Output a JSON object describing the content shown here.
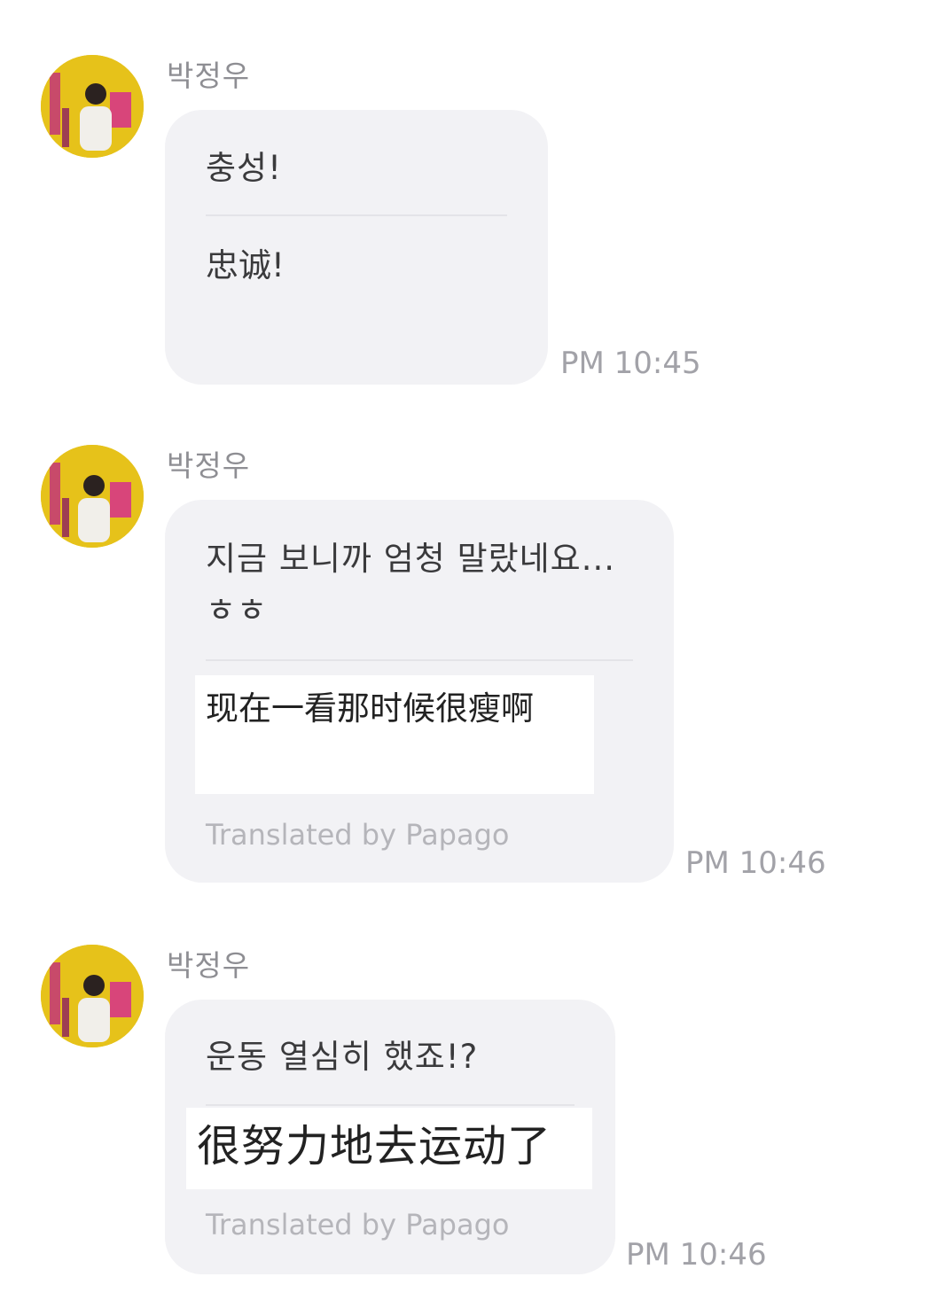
{
  "colors": {
    "bubble": "#f2f2f5",
    "sender": "#8e8e93",
    "timestamp": "#a2a2a8",
    "credit": "#b5b5ba",
    "avatar_background": "#e8c51b"
  },
  "messages": [
    {
      "sender": "박정우",
      "avatar_icon": "profile-photo-avatar",
      "original": "충성!",
      "translation": "忠诚!",
      "credit": "",
      "time": "PM 10:45"
    },
    {
      "sender": "박정우",
      "avatar_icon": "profile-photo-avatar",
      "original": "지금 보니까 엄청 말랐네요...ㅎㅎ",
      "translation": "现在一看那时候很瘦啊",
      "credit": "Translated by Papago",
      "time": "PM 10:46"
    },
    {
      "sender": "박정우",
      "avatar_icon": "profile-photo-avatar",
      "original": "운동 열심히 했죠!?",
      "translation": "很努力地去运动了",
      "credit": "Translated by Papago",
      "time": "PM 10:46"
    }
  ]
}
